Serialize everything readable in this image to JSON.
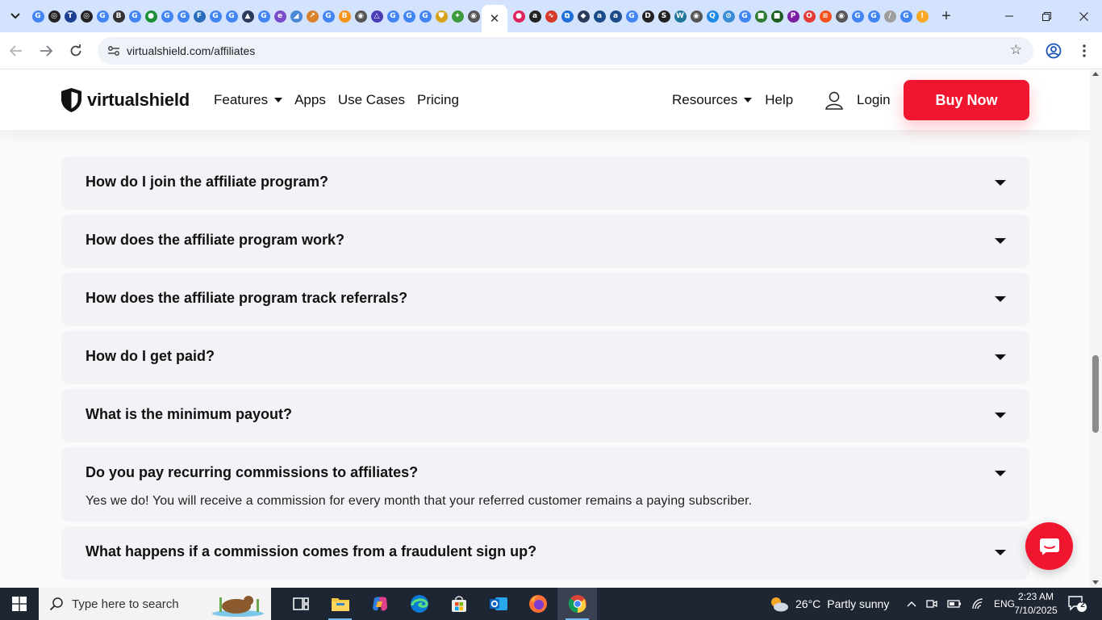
{
  "browser": {
    "url": "virtualshield.com/affiliates",
    "active_tab_close": "✕",
    "new_tab": "+",
    "tab_favicons": [
      {
        "glyph": "G",
        "color": "#4285f4"
      },
      {
        "glyph": "◎",
        "color": "#222222"
      },
      {
        "glyph": "T",
        "color": "#1c3f94"
      },
      {
        "glyph": "◎",
        "color": "#222222"
      },
      {
        "glyph": "G",
        "color": "#4285f4"
      },
      {
        "glyph": "B",
        "color": "#333333"
      },
      {
        "glyph": "G",
        "color": "#4285f4"
      },
      {
        "glyph": "●",
        "color": "#1b8f3a"
      },
      {
        "glyph": "G",
        "color": "#4285f4"
      },
      {
        "glyph": "G",
        "color": "#4285f4"
      },
      {
        "glyph": "F",
        "color": "#2a6ebb"
      },
      {
        "glyph": "G",
        "color": "#4285f4"
      },
      {
        "glyph": "G",
        "color": "#4285f4"
      },
      {
        "glyph": "▲",
        "color": "#2b3a5c"
      },
      {
        "glyph": "G",
        "color": "#4285f4"
      },
      {
        "glyph": "e",
        "color": "#7a4cc9"
      },
      {
        "glyph": "◢",
        "color": "#4a88d6"
      },
      {
        "glyph": "↗",
        "color": "#d9822b"
      },
      {
        "glyph": "G",
        "color": "#4285f4"
      },
      {
        "glyph": "B",
        "color": "#f7931a"
      },
      {
        "glyph": "◉",
        "color": "#555555"
      },
      {
        "glyph": "△",
        "color": "#4b3bb5"
      },
      {
        "glyph": "G",
        "color": "#4285f4"
      },
      {
        "glyph": "G",
        "color": "#4285f4"
      },
      {
        "glyph": "G",
        "color": "#4285f4"
      },
      {
        "glyph": "⛊",
        "color": "#d9a21b"
      },
      {
        "glyph": "✦",
        "color": "#3d9a3d"
      },
      {
        "glyph": "◉",
        "color": "#555555"
      }
    ],
    "tab_favicons_right": [
      {
        "glyph": "●",
        "color": "#e0245e"
      },
      {
        "glyph": "a",
        "color": "#222222"
      },
      {
        "glyph": "∿",
        "color": "#d63a2b"
      },
      {
        "glyph": "⧉",
        "color": "#1e6fd9"
      },
      {
        "glyph": "◆",
        "color": "#2b3a5c"
      },
      {
        "glyph": "a",
        "color": "#1b4b8a"
      },
      {
        "glyph": "a",
        "color": "#1b4b8a"
      },
      {
        "glyph": "G",
        "color": "#4285f4"
      },
      {
        "glyph": "D",
        "color": "#222222"
      },
      {
        "glyph": "S",
        "color": "#222222"
      },
      {
        "glyph": "W",
        "color": "#21759b"
      },
      {
        "glyph": "◉",
        "color": "#555555"
      },
      {
        "glyph": "Q",
        "color": "#1e88e5"
      },
      {
        "glyph": "⊘",
        "color": "#3b8ed6"
      },
      {
        "glyph": "G",
        "color": "#4285f4"
      },
      {
        "glyph": "■",
        "color": "#2e7d32"
      },
      {
        "glyph": "■",
        "color": "#1b5e20"
      },
      {
        "glyph": "P",
        "color": "#7b1fa2"
      },
      {
        "glyph": "O",
        "color": "#e53935"
      },
      {
        "glyph": "≡",
        "color": "#f4511e"
      },
      {
        "glyph": "◉",
        "color": "#555555"
      },
      {
        "glyph": "G",
        "color": "#4285f4"
      },
      {
        "glyph": "G",
        "color": "#4285f4"
      },
      {
        "glyph": "/",
        "color": "#9e9e9e"
      },
      {
        "glyph": "G",
        "color": "#4285f4"
      },
      {
        "glyph": "!",
        "color": "#f9a825"
      }
    ]
  },
  "site": {
    "logo_text": "virtualshield",
    "nav": {
      "features": "Features",
      "apps": "Apps",
      "use_cases": "Use Cases",
      "pricing": "Pricing",
      "resources": "Resources",
      "help": "Help",
      "login": "Login",
      "buy_now": "Buy Now"
    },
    "brand_color": "#f0162f"
  },
  "faq": [
    {
      "question": "How do I join the affiliate program?",
      "open": false
    },
    {
      "question": "How does the affiliate program work?",
      "open": false
    },
    {
      "question": "How does the affiliate program track referrals?",
      "open": false
    },
    {
      "question": "How do I get paid?",
      "open": false
    },
    {
      "question": "What is the minimum payout?",
      "open": false
    },
    {
      "question": "Do you pay recurring commissions to affiliates?",
      "open": true,
      "answer": "Yes we do! You will receive a commission for every month that your referred customer remains a paying subscriber."
    },
    {
      "question": "What happens if a commission comes from a fraudulent sign up?",
      "open": false
    }
  ],
  "taskbar": {
    "search_placeholder": "Type here to search",
    "apps": [
      "task-view",
      "file-explorer",
      "copilot",
      "edge",
      "microsoft-store",
      "outlook",
      "firefox",
      "chrome"
    ],
    "weather": {
      "temp": "26°C",
      "condition": "Partly sunny"
    },
    "language": "ENG",
    "time": "2:23 AM",
    "date": "7/10/2025",
    "notification_count": "2"
  }
}
